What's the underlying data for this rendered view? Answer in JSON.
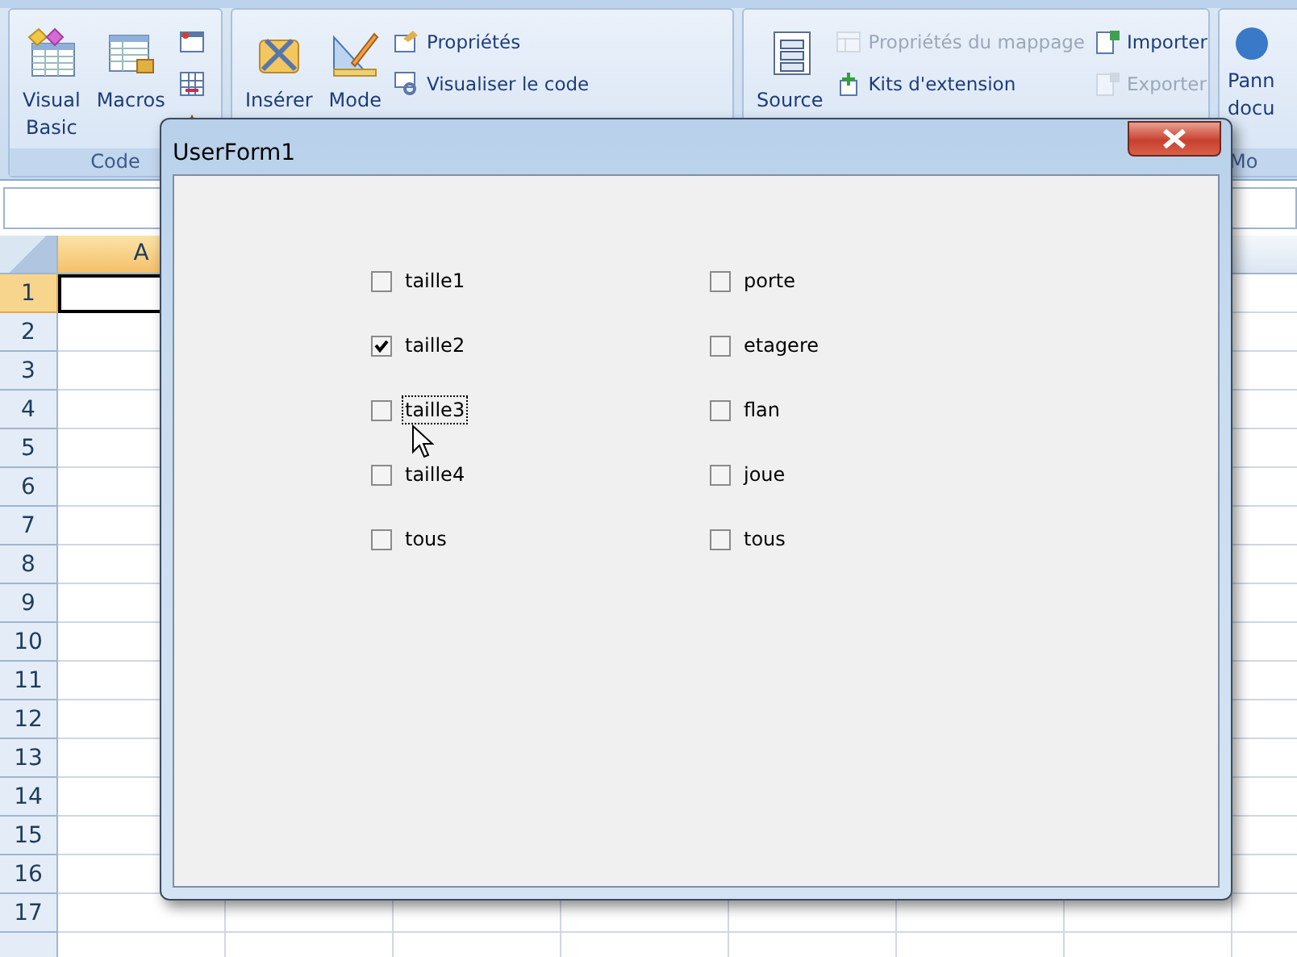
{
  "ribbon": {
    "groups": [
      {
        "label": "Code",
        "columns": [
          [
            {
              "kind": "large",
              "label": "Visual\nBasic",
              "disabled": false
            }
          ],
          [
            {
              "kind": "large",
              "label": "Macros",
              "disabled": false
            }
          ],
          [
            {
              "kind": "icon",
              "disabled": false
            },
            {
              "kind": "icon",
              "disabled": false
            },
            {
              "kind": "icon",
              "disabled": false
            }
          ]
        ]
      },
      {
        "columns": [
          [
            {
              "kind": "large",
              "label": "Insérer",
              "disabled": false
            }
          ],
          [
            {
              "kind": "large",
              "label": "Mode",
              "disabled": false
            }
          ],
          [
            {
              "kind": "small",
              "label": "Propriétés",
              "disabled": false
            },
            {
              "kind": "small",
              "label": "Visualiser le code",
              "disabled": false
            }
          ]
        ]
      },
      {
        "columns": [
          [
            {
              "kind": "large",
              "label": "Source",
              "disabled": false
            }
          ],
          [
            {
              "kind": "small",
              "label": "Propriétés du mappage",
              "disabled": true
            },
            {
              "kind": "small",
              "label": "Kits d'extension",
              "disabled": false
            }
          ],
          [
            {
              "kind": "small",
              "label": "Importer",
              "disabled": false
            },
            {
              "kind": "small",
              "label": "Exporter",
              "disabled": true
            }
          ]
        ]
      },
      {
        "label": "Mo",
        "columns": [
          [
            {
              "kind": "large",
              "label": "Pann\ndocu",
              "disabled": false
            }
          ]
        ]
      }
    ]
  },
  "sheet": {
    "columns": [
      {
        "label": "A",
        "selected": true
      }
    ],
    "rows": [
      {
        "label": "1",
        "selected": true
      },
      {
        "label": "2",
        "selected": false
      },
      {
        "label": "3",
        "selected": false
      },
      {
        "label": "4",
        "selected": false
      },
      {
        "label": "5",
        "selected": false
      },
      {
        "label": "6",
        "selected": false
      },
      {
        "label": "7",
        "selected": false
      },
      {
        "label": "8",
        "selected": false
      },
      {
        "label": "9",
        "selected": false
      },
      {
        "label": "10",
        "selected": false
      },
      {
        "label": "11",
        "selected": false
      },
      {
        "label": "12",
        "selected": false
      },
      {
        "label": "13",
        "selected": false
      },
      {
        "label": "14",
        "selected": false
      },
      {
        "label": "15",
        "selected": false
      },
      {
        "label": "16",
        "selected": false
      },
      {
        "label": "17",
        "selected": false
      }
    ]
  },
  "dialog": {
    "title": "UserForm1",
    "checkbox_columns": [
      [
        {
          "label": "taille1",
          "checked": false,
          "focused": false
        },
        {
          "label": "taille2",
          "checked": true,
          "focused": false
        },
        {
          "label": "taille3",
          "checked": false,
          "focused": true
        },
        {
          "label": "taille4",
          "checked": false,
          "focused": false
        },
        {
          "label": "tous",
          "checked": false,
          "focused": false
        }
      ],
      [
        {
          "label": "porte",
          "checked": false,
          "focused": false
        },
        {
          "label": "etagere",
          "checked": false,
          "focused": false
        },
        {
          "label": "flan",
          "checked": false,
          "focused": false
        },
        {
          "label": "joue",
          "checked": false,
          "focused": false
        },
        {
          "label": "tous",
          "checked": false,
          "focused": false
        }
      ]
    ]
  }
}
